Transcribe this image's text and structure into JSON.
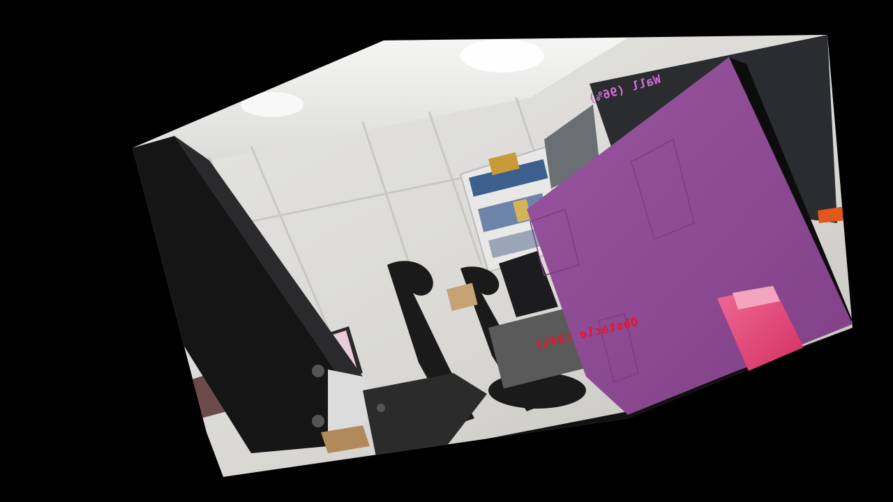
{
  "detections": [
    {
      "label": "Wall (96%)",
      "color": "#d36fd8"
    },
    {
      "label": "Obstacle (94%)",
      "color": "#e8152b"
    }
  ],
  "overlay_colors": {
    "wall_face": "#8e4a94",
    "obstacle_box": "#e23a6e",
    "background": "#000000"
  }
}
